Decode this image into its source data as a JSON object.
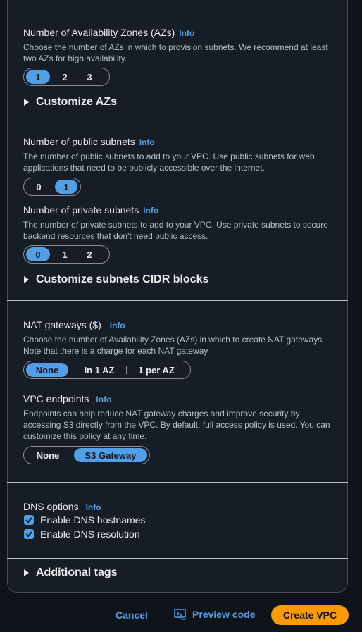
{
  "az": {
    "label": "Number of Availability Zones (AZs)",
    "info": "Info",
    "desc": "Choose the number of AZs in which to provision subnets. We recommend at least two AZs for high availability.",
    "options": [
      "1",
      "2",
      "3"
    ],
    "selected": "1",
    "customize": "Customize AZs"
  },
  "public_subnets": {
    "label": "Number of public subnets",
    "info": "Info",
    "desc": "The number of public subnets to add to your VPC. Use public subnets for web applications that need to be publicly accessible over the internet.",
    "options": [
      "0",
      "1"
    ],
    "selected": "1"
  },
  "private_subnets": {
    "label": "Number of private subnets",
    "info": "Info",
    "desc": "The number of private subnets to add to your VPC. Use private subnets to secure backend resources that don't need public access.",
    "options": [
      "0",
      "1",
      "2"
    ],
    "selected": "0",
    "customize": "Customize subnets CIDR blocks"
  },
  "nat": {
    "label": "NAT gateways ($)",
    "info": "Info",
    "desc": "Choose the number of Availability Zones (AZs) in which to create NAT gateways. Note that there is a charge for each NAT gateway",
    "options": [
      "None",
      "In 1 AZ",
      "1 per AZ"
    ],
    "selected": "None"
  },
  "endpoints": {
    "label": "VPC endpoints",
    "info": "Info",
    "desc": "Endpoints can help reduce NAT gateway charges and improve security by accessing S3 directly from the VPC. By default, full access policy is used. You can customize this policy at any time.",
    "options": [
      "None",
      "S3 Gateway"
    ],
    "selected": "S3 Gateway"
  },
  "dns": {
    "label": "DNS options",
    "info": "Info",
    "hostnames": "Enable DNS hostnames",
    "resolution": "Enable DNS resolution",
    "hostnames_checked": true,
    "resolution_checked": true
  },
  "tags": {
    "label": "Additional tags"
  },
  "footer": {
    "cancel": "Cancel",
    "preview": "Preview code",
    "create": "Create VPC"
  },
  "colors": {
    "accent": "#539fe5",
    "primary": "#ff9900",
    "panel": "#161d26",
    "background": "#0f141a"
  }
}
